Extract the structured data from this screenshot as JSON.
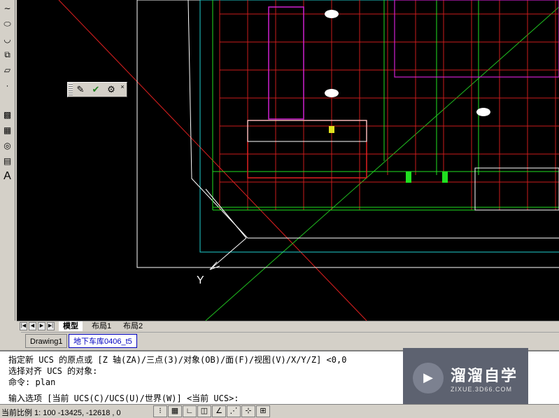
{
  "left_toolbar": {
    "items": [
      {
        "name": "spline-icon",
        "glyph": "∼"
      },
      {
        "name": "ellipse-icon",
        "glyph": "⬭"
      },
      {
        "name": "ellipse-arc-icon",
        "glyph": "◡"
      },
      {
        "name": "insert-block-icon",
        "glyph": "⧉"
      },
      {
        "name": "make-block-icon",
        "glyph": "▱"
      },
      {
        "name": "point-icon",
        "glyph": "·"
      },
      {
        "name": "hatch-icon",
        "glyph": "▩"
      },
      {
        "name": "gradient-icon",
        "glyph": "▦"
      },
      {
        "name": "region-icon",
        "glyph": "◎"
      },
      {
        "name": "table-icon",
        "glyph": "▤"
      },
      {
        "name": "multiline-text-icon",
        "glyph": "A"
      }
    ]
  },
  "float_toolbar": {
    "close": "×",
    "buttons": [
      {
        "name": "ucs-edit-icon",
        "glyph": "✎"
      },
      {
        "name": "apply-check-icon",
        "glyph": "✔"
      },
      {
        "name": "ucs-settings-icon",
        "glyph": "⚙"
      }
    ]
  },
  "ucs": {
    "y_label": "Y"
  },
  "layout_tabs": {
    "nav": [
      "|◀",
      "◀",
      "▶",
      "▶|"
    ],
    "tabs": [
      "模型",
      "布局1",
      "布局2"
    ]
  },
  "doc_tabs": [
    "Drawing1",
    "地下车库0406_t5"
  ],
  "command": {
    "lines": [
      "指定新 UCS 的原点或 [Z 轴(ZA)/三点(3)/对象(OB)/面(F)/视图(V)/X/Y/Z] <0,0",
      "选择对齐 UCS 的对象:",
      "命令: plan",
      "输入选项 [当前 UCS(C)/UCS(U)/世界(W)] <当前 UCS>:"
    ]
  },
  "watermark": {
    "title": "溜溜自学",
    "subtitle": "ZIXUE.3D66.COM"
  },
  "status": {
    "coords": "当前比例 1: 100  -13425, -12618 , 0",
    "buttons": [
      "⁝",
      "▦",
      "∟",
      "◫",
      "∠",
      "⋰",
      "⊹",
      "⊞"
    ]
  },
  "colors": {
    "red": "#e02020",
    "green": "#20e020",
    "white": "#ffffff",
    "cyan": "#20d0d0",
    "magenta": "#d020d0",
    "yellow": "#e0e020",
    "brand": "#5d6270"
  }
}
